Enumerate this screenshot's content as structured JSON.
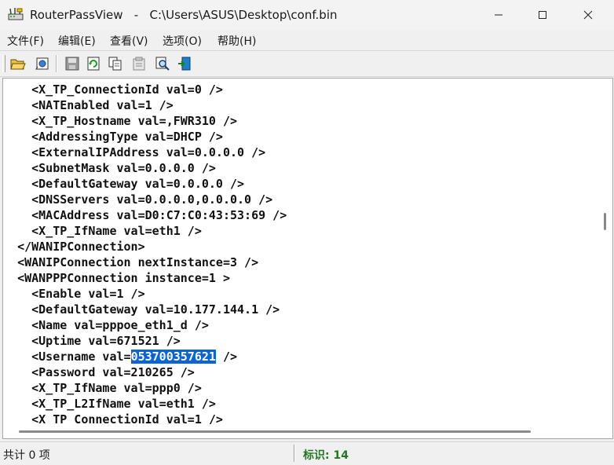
{
  "window": {
    "title": "RouterPassView   -   C:\\Users\\ASUS\\Desktop\\conf.bin",
    "app_icon": "routerpassview-icon",
    "controls": [
      "minimize-icon",
      "maximize-icon",
      "close-icon"
    ]
  },
  "menu": {
    "items": [
      {
        "label": "文件(F)"
      },
      {
        "label": "编辑(E)"
      },
      {
        "label": "查看(V)"
      },
      {
        "label": "选项(O)"
      },
      {
        "label": "帮助(H)"
      }
    ]
  },
  "toolbar": {
    "buttons": [
      {
        "icon": "open-file-icon"
      },
      {
        "icon": "open-config-icon"
      },
      {
        "icon": "save-icon"
      },
      {
        "icon": "refresh-icon"
      },
      {
        "icon": "copy-icon"
      },
      {
        "icon": "properties-icon"
      },
      {
        "icon": "find-icon"
      },
      {
        "icon": "exit-icon"
      }
    ]
  },
  "editor": {
    "lines": [
      {
        "indent": "    ",
        "text": "<X_TP_ConnectionId val=0 />"
      },
      {
        "indent": "    ",
        "text": "<NATEnabled val=1 />"
      },
      {
        "indent": "    ",
        "text": "<X_TP_Hostname val=,FWR310 />"
      },
      {
        "indent": "    ",
        "text": "<AddressingType val=DHCP />"
      },
      {
        "indent": "    ",
        "text": "<ExternalIPAddress val=0.0.0.0 />"
      },
      {
        "indent": "    ",
        "text": "<SubnetMask val=0.0.0.0 />"
      },
      {
        "indent": "    ",
        "text": "<DefaultGateway val=0.0.0.0 />"
      },
      {
        "indent": "    ",
        "text": "<DNSServers val=0.0.0.0,0.0.0.0 />"
      },
      {
        "indent": "    ",
        "text": "<MACAddress val=D0:C7:C0:43:53:69 />"
      },
      {
        "indent": "    ",
        "text": "<X_TP_IfName val=eth1 />"
      },
      {
        "indent": "  ",
        "text": "</WANIPConnection>"
      },
      {
        "indent": "  ",
        "text": "<WANIPConnection nextInstance=3 />"
      },
      {
        "indent": "  ",
        "text": "<WANPPPConnection instance=1 >"
      },
      {
        "indent": "    ",
        "text": "<Enable val=1 />"
      },
      {
        "indent": "    ",
        "text": "<DefaultGateway val=10.177.144.1 />"
      },
      {
        "indent": "    ",
        "text": "<Name val=pppoe_eth1_d />"
      },
      {
        "indent": "    ",
        "text": "<Uptime val=671521 />"
      },
      {
        "indent": "    ",
        "before": "<Username val=",
        "selected": "053700357621",
        "after": " />"
      },
      {
        "indent": "    ",
        "text": "<Password val=210265 />"
      },
      {
        "indent": "    ",
        "text": "<X_TP_IfName val=ppp0 />"
      },
      {
        "indent": "    ",
        "text": "<X_TP_L2IfName val=eth1 />"
      },
      {
        "indent": "    ",
        "text": "<X_TP_ConnectionId val=1 />"
      }
    ]
  },
  "status": {
    "left": "共计 0 项",
    "right": "标识: 14"
  }
}
